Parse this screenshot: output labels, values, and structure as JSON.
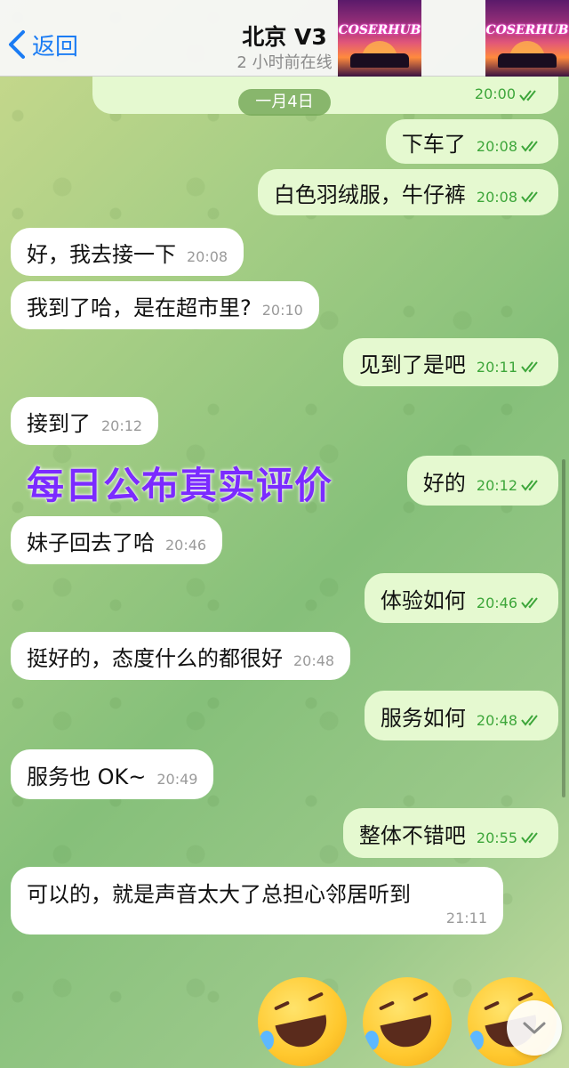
{
  "header": {
    "back_label": "返回",
    "title": "北京 V3",
    "subtitle": "2 小时前在线",
    "logo_text": "COSERHUB"
  },
  "date_chip": "一月4日",
  "top_partial": {
    "time": "20:00"
  },
  "messages": [
    {
      "dir": "out",
      "text": "下车了",
      "time": "20:08"
    },
    {
      "dir": "out",
      "text": "白色羽绒服，牛仔裤",
      "time": "20:08"
    },
    {
      "dir": "in",
      "text": "好，我去接一下",
      "time": "20:08"
    },
    {
      "dir": "in",
      "text": "我到了哈，是在超市里?",
      "time": "20:10"
    },
    {
      "dir": "out",
      "text": "见到了是吧",
      "time": "20:11"
    },
    {
      "dir": "in",
      "text": "接到了",
      "time": "20:12"
    },
    {
      "dir": "out",
      "text": "好的",
      "time": "20:12"
    },
    {
      "dir": "in",
      "text": "妹子回去了哈",
      "time": "20:46"
    },
    {
      "dir": "out",
      "text": "体验如何",
      "time": "20:46"
    },
    {
      "dir": "in",
      "text": "挺好的，态度什么的都很好",
      "time": "20:48"
    },
    {
      "dir": "out",
      "text": "服务如何",
      "time": "20:48"
    },
    {
      "dir": "in",
      "text": "服务也 OK~",
      "time": "20:49"
    },
    {
      "dir": "out",
      "text": "整体不错吧",
      "time": "20:55"
    },
    {
      "dir": "in",
      "text": "可以的，就是声音太大了总担心邻居听到",
      "time": "21:11"
    }
  ],
  "watermark": "每日公布真实评价",
  "colors": {
    "accent": "#1b7cf4",
    "outgoing_bubble": "#e5f9d0",
    "incoming_bubble": "#ffffff",
    "read_check": "#3da63a",
    "watermark": "#7b2bff"
  },
  "icons": {
    "back": "chevron-left-icon",
    "read": "double-check-icon",
    "scroll": "chevron-down-icon",
    "emoji": "rolling-on-floor-laughing-emoji"
  }
}
